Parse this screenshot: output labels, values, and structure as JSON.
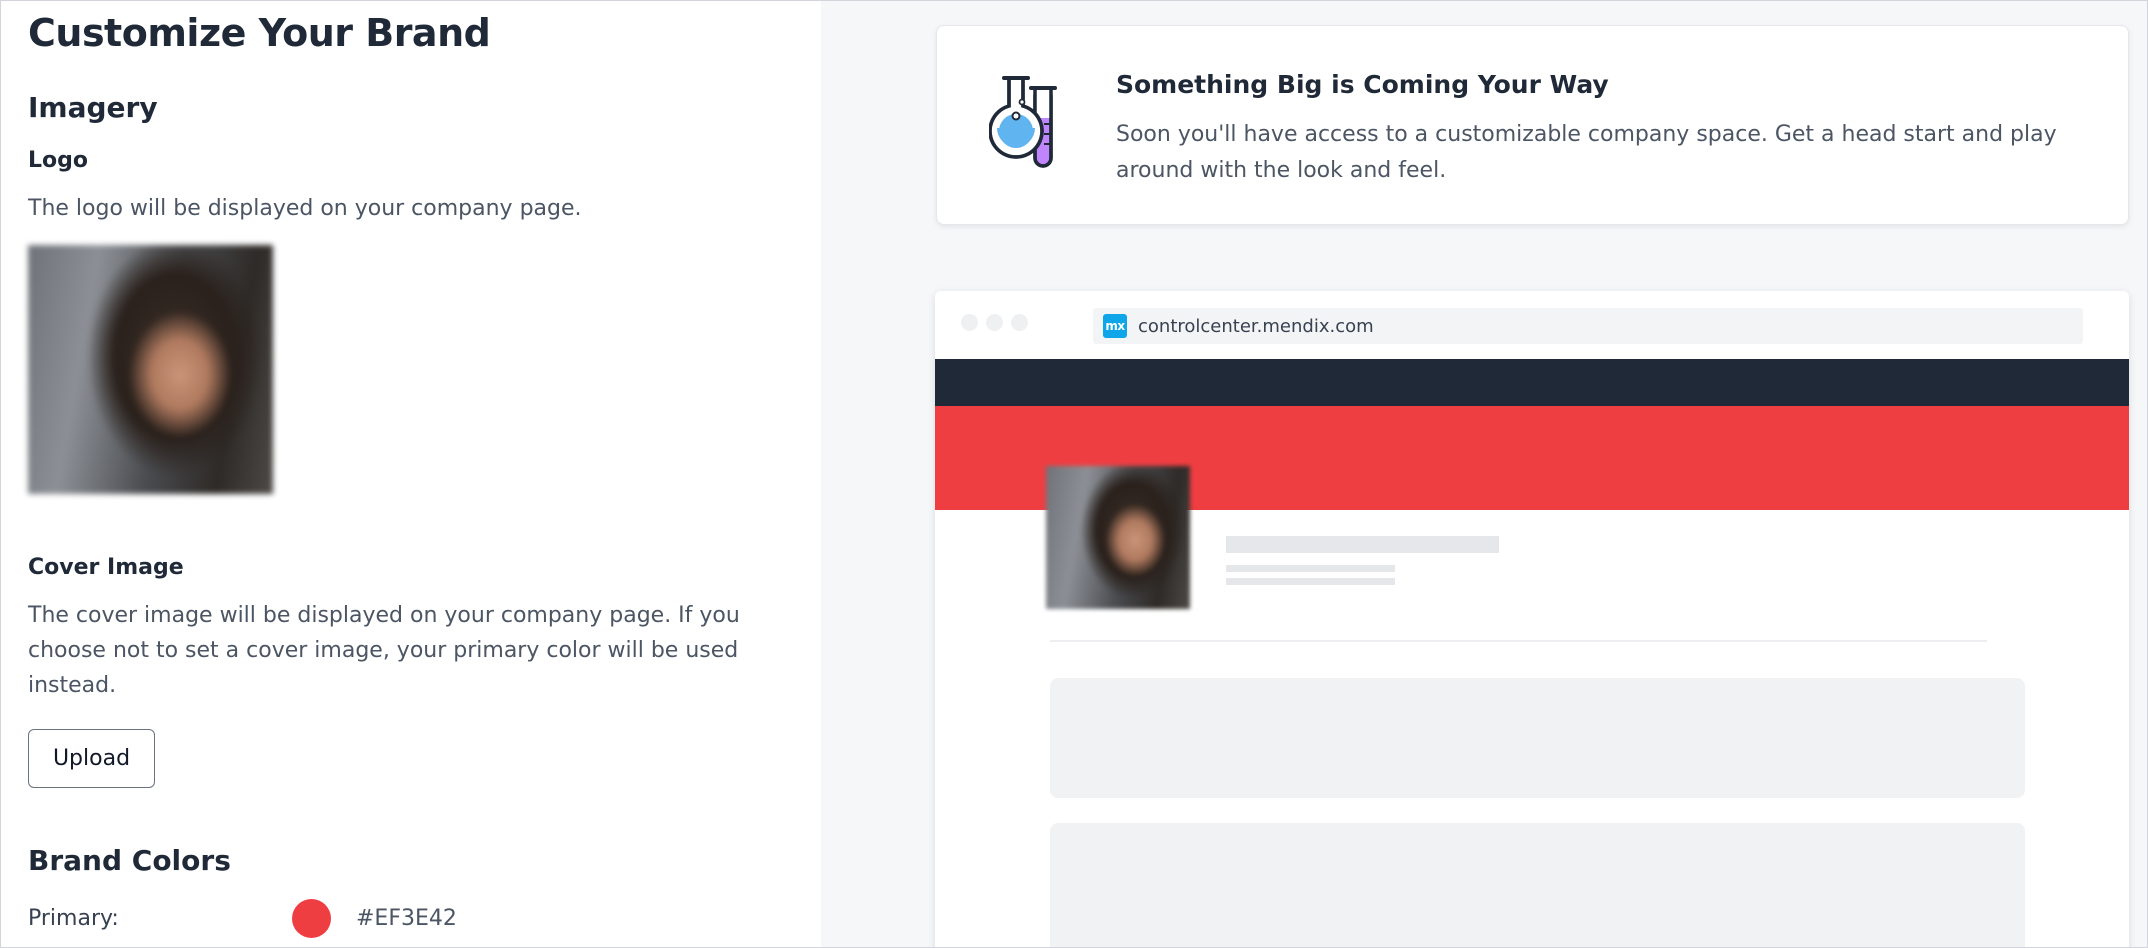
{
  "page": {
    "title": "Customize Your Brand"
  },
  "imagery": {
    "heading": "Imagery",
    "logo_label": "Logo",
    "logo_help": "The logo will be displayed on your company page.",
    "cover_label": "Cover Image",
    "cover_help_line1": "The cover image will be displayed on your company page. If you",
    "cover_help_line2": "choose not to set a cover image, your primary color will be used",
    "cover_help_line3": "instead.",
    "upload_label": "Upload"
  },
  "brand_colors": {
    "heading": "Brand Colors",
    "primary_label": "Primary:",
    "primary_hex": "#EF3E42",
    "primary_color": "#EF3E42"
  },
  "notice": {
    "icon": "lab-flask-icon",
    "title": "Something Big is Coming Your Way",
    "body": "Soon you'll have access to a customizable company space. Get a head start and play around with the look and feel."
  },
  "preview": {
    "badge": "mx",
    "url": "controlcenter.mendix.com",
    "navbar_color": "#1F2937"
  }
}
